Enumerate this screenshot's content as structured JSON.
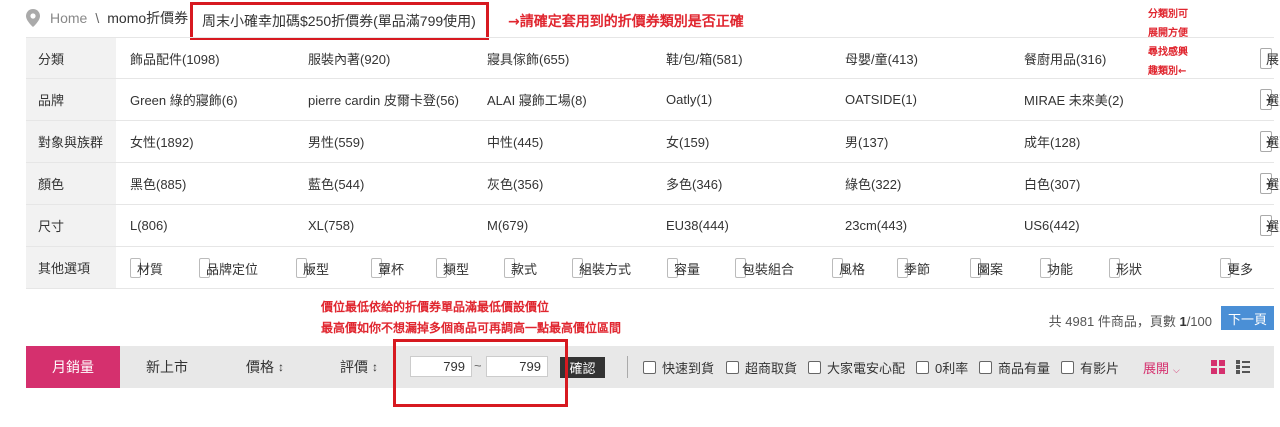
{
  "breadcrumb": {
    "home": "Home",
    "separator": "\\",
    "category": "momo折價券",
    "current": "周末小確幸加碼$250折價券(單品滿799使用)"
  },
  "annotations": {
    "top_right": "→請確定套用到的折價券類別是否正確",
    "side": [
      "分類別可",
      "展開方便",
      "尋找感興",
      "趣類別←"
    ],
    "price_note_1": "價位最低依給的折價券單品滿最低價設價位",
    "price_note_2": "最高價如你不想漏掉多個商品可再調高一點最高價位區間"
  },
  "filters": [
    {
      "label": "分類",
      "values": [
        "飾品配件(1098)",
        "服裝內著(920)",
        "寢具傢飾(655)",
        "鞋/包/箱(581)",
        "母嬰/童(413)",
        "餐廚用品(316)"
      ],
      "button": "展開",
      "button_type": "expand"
    },
    {
      "label": "品牌",
      "values": [
        "Green 綠的寢飾(6)",
        "pierre cardin 皮爾卡登(56)",
        "ALAI 寢飾工場(8)",
        "Oatly(1)",
        "OATSIDE(1)",
        "MIRAE 未來美(2)"
      ],
      "button": "選更多",
      "button_type": "more"
    },
    {
      "label": "對象與族群",
      "values": [
        "女性(1892)",
        "男性(559)",
        "中性(445)",
        "女(159)",
        "男(137)",
        "成年(128)"
      ],
      "button": "選更多",
      "button_type": "more"
    },
    {
      "label": "顏色",
      "values": [
        "黑色(885)",
        "藍色(544)",
        "灰色(356)",
        "多色(346)",
        "綠色(322)",
        "白色(307)"
      ],
      "button": "選更多",
      "button_type": "more"
    },
    {
      "label": "尺寸",
      "values": [
        "L(806)",
        "XL(758)",
        "M(679)",
        "EU38(444)",
        "23cm(443)",
        "US6(442)"
      ],
      "button": "選更多",
      "button_type": "more"
    }
  ],
  "other_options": {
    "label": "其他選項",
    "dropdowns": [
      "材質",
      "品牌定位",
      "版型",
      "罩杯",
      "類型",
      "款式",
      "組裝方式",
      "容量",
      "包裝組合",
      "風格",
      "季節",
      "圖案",
      "功能",
      "形狀"
    ],
    "more": "更多"
  },
  "pagination": {
    "total_prefix": "共 4981 件商品，頁數",
    "current_page": "1",
    "total_pages": "/100",
    "next": "下一頁"
  },
  "sortbar": {
    "active": "月銷量",
    "new": "新上市",
    "price": "價格",
    "rating": "評價",
    "price_min": "799",
    "price_max": "799",
    "tilde": "~",
    "confirm": "確認",
    "checkboxes": [
      "快速到貨",
      "超商取貨",
      "大家電安心配",
      "0利率",
      "商品有量",
      "有影片"
    ],
    "expand": "展開"
  },
  "colors": {
    "accent": "#d5306e",
    "annotation_red": "#d71920",
    "next_button": "#4a8fd6"
  }
}
